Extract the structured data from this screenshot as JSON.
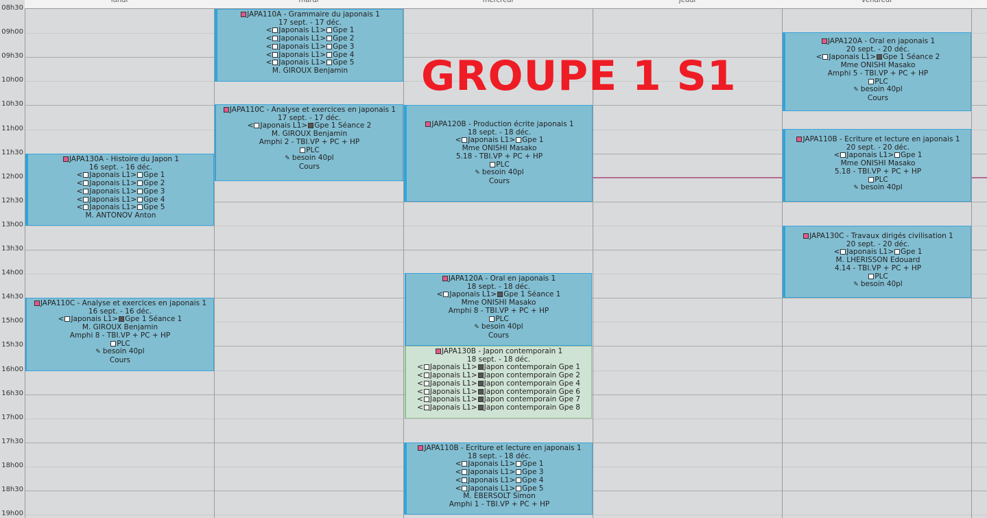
{
  "days": [
    "lundi",
    "mardi",
    "mercredi",
    "jeudi",
    "vendredi"
  ],
  "times": [
    "08h30",
    "09h00",
    "09h30",
    "10h00",
    "10h30",
    "11h00",
    "11h30",
    "12h00",
    "12h30",
    "13h00",
    "13h30",
    "14h00",
    "14h30",
    "15h00",
    "15h30",
    "16h00",
    "16h30",
    "17h00",
    "17h30",
    "18h00",
    "18h30",
    "19h00"
  ],
  "title": "GROUPE 1 S1",
  "events": {
    "lundi_1": {
      "code": "JAPA130A - Histoire du Japon 1",
      "dates": "16 sept. - 16 déc.",
      "groups": [
        "Gpe 1",
        "Gpe 2",
        "Gpe 3",
        "Gpe 4",
        "Gpe 5"
      ],
      "teacher": "M. ANTONOV Anton"
    },
    "lundi_2": {
      "code": "JAPA110C - Analyse et exercices en japonais 1",
      "dates": "16 sept. - 16 déc.",
      "group": "Gpe 1 Séance 1",
      "teacher": "M. GIROUX Benjamin",
      "room": "Amphi 8 - TBI.VP + PC + HP",
      "plc": "PLC",
      "need": "besoin 40pl",
      "type": "Cours"
    },
    "mardi_1": {
      "code": "JAPA110A - Grammaire du japonais 1",
      "dates": "17 sept. - 17 déc.",
      "groups": [
        "Gpe 1",
        "Gpe 2",
        "Gpe 3",
        "Gpe 4",
        "Gpe 5"
      ],
      "teacher": "M. GIROUX Benjamin"
    },
    "mardi_2": {
      "code": "JAPA110C - Analyse et exercices en japonais 1",
      "dates": "17 sept. - 17 déc.",
      "group": "Gpe 1 Séance 2",
      "teacher": "M. GIROUX Benjamin",
      "room": "Amphi 2 - TBI.VP + PC + HP",
      "plc": "PLC",
      "need": "besoin 40pl",
      "type": "Cours"
    },
    "mercredi_1": {
      "code": "JAPA120B - Production écrite japonais 1",
      "dates": "18 sept. - 18 déc.",
      "group": "Gpe 1",
      "teacher": "Mme ONISHI Masako",
      "room": "5.18 - TBI.VP + PC + HP",
      "plc": "PLC",
      "need": "besoin 40pl",
      "type": "Cours"
    },
    "mercredi_2": {
      "code": "JAPA120A - Oral en japonais 1",
      "dates": "18 sept. - 18 déc.",
      "group": "Gpe 1 Séance 1",
      "teacher": "Mme ONISHI Masako",
      "room": "Amphi 8 - TBI.VP + PC + HP",
      "plc": "PLC",
      "need": "besoin 40pl",
      "type": "Cours"
    },
    "mercredi_3": {
      "code": "JAPA130B - Japon contemporain 1",
      "dates": "18 sept. - 18 déc.",
      "groups": [
        "Japon contemporain Gpe 1",
        "Japon contemporain Gpe 2",
        "Japon contemporain Gpe 4",
        "Japon contemporain Gpe 6",
        "Japon contemporain Gpe 7",
        "Japon contemporain Gpe 8"
      ]
    },
    "mercredi_4": {
      "code": "JAPA110B - Ecriture et lecture en japonais 1",
      "dates": "18 sept. - 18 déc.",
      "groups": [
        "Gpe 1",
        "Gpe 3",
        "Gpe 4",
        "Gpe 5"
      ],
      "teacher": "M. EBERSOLT Simon",
      "room": "Amphi 1 - TBI.VP + PC + HP"
    },
    "vendredi_1": {
      "code": "JAPA120A - Oral en japonais 1",
      "dates": "20 sept. - 20 déc.",
      "group": "Gpe 1 Séance 2",
      "teacher": "Mme ONISHI Masako",
      "room": "Amphi 5 - TBI.VP + PC + HP",
      "plc": "PLC",
      "need": "besoin 40pl",
      "type": "Cours"
    },
    "vendredi_2": {
      "code": "JAPA110B - Ecriture et lecture en japonais 1",
      "dates": "20 sept. - 20 déc.",
      "group": "Gpe 1",
      "teacher": "Mme ONISHI Masako",
      "room": "5.18 - TBI.VP + PC + HP",
      "plc": "PLC",
      "need": "besoin 40pl"
    },
    "vendredi_3": {
      "code": "JAPA130C - Travaux dirigés civilisation 1",
      "dates": "20 sept. - 20 déc.",
      "group": "Gpe 1",
      "teacher": "M. LHERISSON Edouard",
      "room": "4.14 - TBI.VP + PC + HP",
      "plc": "PLC",
      "need": "besoin 40pl"
    }
  },
  "prefix": {
    "lt": "<",
    "level": "Japonais L1>"
  }
}
